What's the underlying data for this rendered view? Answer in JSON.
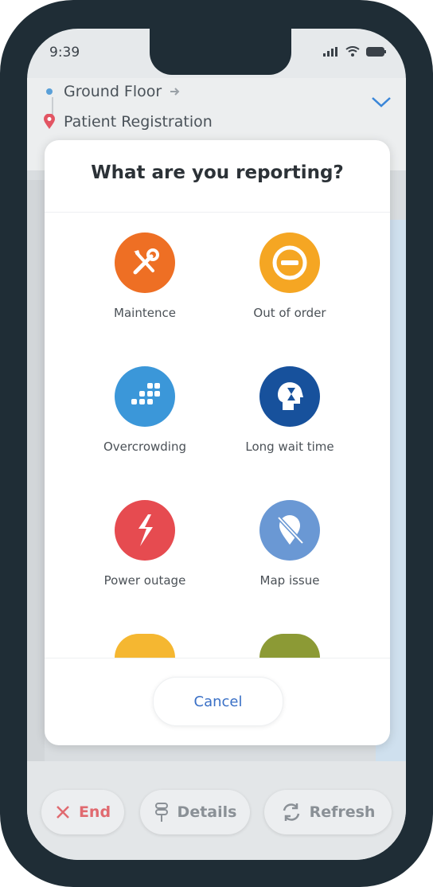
{
  "status_bar": {
    "time": "9:39"
  },
  "route": {
    "from": "Ground Floor",
    "to": "Patient Registration"
  },
  "modal": {
    "title": "What are you reporting?",
    "options": [
      {
        "label": "Maintence",
        "icon": "wrench-screwdriver-icon",
        "color": "#ee6f24"
      },
      {
        "label": "Out of order",
        "icon": "minus-circle-icon",
        "color": "#f5a623"
      },
      {
        "label": "Overcrowding",
        "icon": "crowd-icon",
        "color": "#3b97d9"
      },
      {
        "label": "Long wait time",
        "icon": "head-hourglass-icon",
        "color": "#17519c"
      },
      {
        "label": "Power outage",
        "icon": "lightning-icon",
        "color": "#e64b50"
      },
      {
        "label": "Map issue",
        "icon": "map-pin-off-icon",
        "color": "#6a98d4"
      },
      {
        "label": "",
        "icon": "partial-icon",
        "color": "#f5b731"
      },
      {
        "label": "",
        "icon": "partial-icon",
        "color": "#8c9a35"
      }
    ],
    "cancel_label": "Cancel"
  },
  "bottom_bar": {
    "end_label": "End",
    "details_label": "Details",
    "refresh_label": "Refresh"
  }
}
